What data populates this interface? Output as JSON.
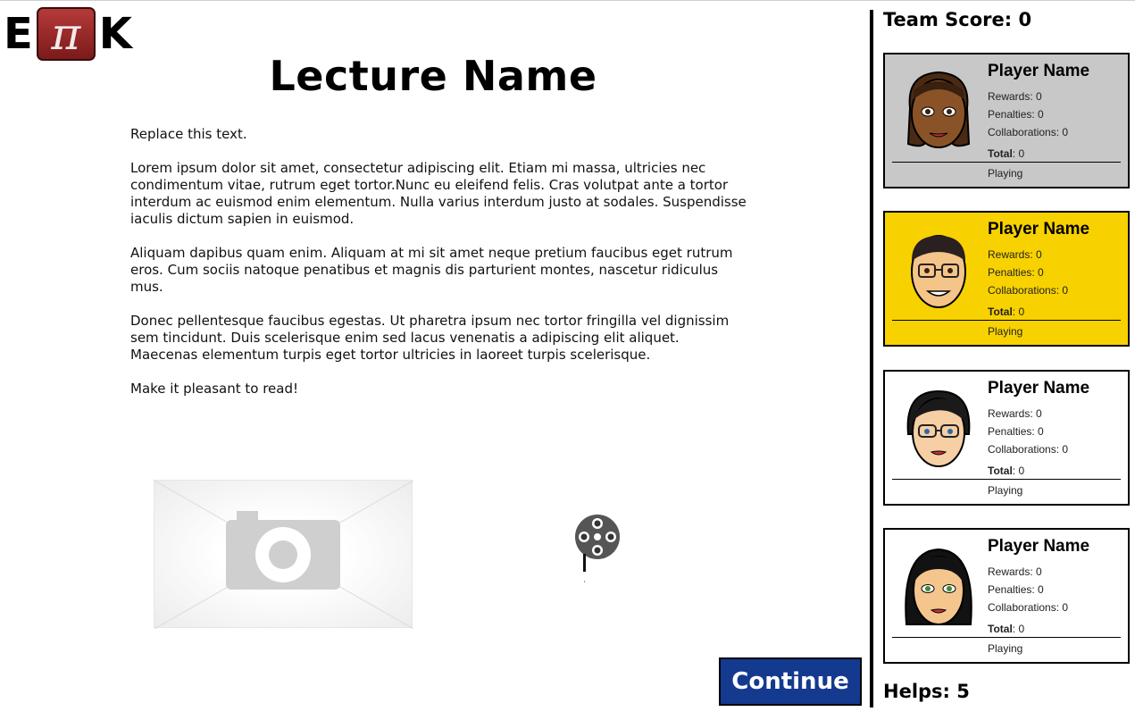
{
  "logo": {
    "left": "E",
    "middle": "π",
    "right": "K"
  },
  "lecture": {
    "title": "Lecture Name",
    "paragraphs": [
      "Replace this text.",
      "Lorem ipsum dolor sit amet, consectetur adipiscing elit. Etiam mi massa, ultricies nec condimentum vitae, rutrum eget tortor.Nunc eu eleifend felis. Cras volutpat ante a tortor interdum ac euismod enim elementum. Nulla varius interdum justo at sodales. Suspendisse iaculis dictum sapien in euismod.",
      "Aliquam dapibus quam enim. Aliquam at mi sit amet neque pretium faucibus eget rutrum eros. Cum sociis natoque penatibus et magnis dis parturient montes, nascetur ridiculus mus.",
      "Donec pellentesque faucibus egestas. Ut pharetra ipsum nec tortor fringilla vel dignissim sem tincidunt. Duis scelerisque enim sed lacus venenatis a adipiscing elit aliquet. Maecenas elementum turpis eget tortor ultricies in laoreet turpis scelerisque.",
      "Make it pleasant to read!"
    ]
  },
  "media": {
    "image_icon": "camera-icon",
    "video_icon": "film-reel-icon"
  },
  "continue_label": "Continue",
  "sidebar": {
    "team_score": "Team Score: 0",
    "helps": "Helps: 5",
    "stat_labels": {
      "rewards": "Rewards:",
      "penalties": "Penalties:",
      "collaborations": "Collaborations:",
      "total": "Total"
    },
    "players": [
      {
        "name": "Player Name",
        "rewards": "0",
        "penalties": "0",
        "collaborations": "0",
        "total": "0",
        "status": "Playing",
        "background": "#c8c8c8",
        "avatar_icon": "avatar-woman-dark-skin-icon"
      },
      {
        "name": "Player Name",
        "rewards": "0",
        "penalties": "0",
        "collaborations": "0",
        "total": "0",
        "status": "Playing",
        "background": "#f8d200",
        "avatar_icon": "avatar-man-glasses-icon"
      },
      {
        "name": "Player Name",
        "rewards": "0",
        "penalties": "0",
        "collaborations": "0",
        "total": "0",
        "status": "Playing",
        "background": "#ffffff",
        "avatar_icon": "avatar-woman-glasses-icon"
      },
      {
        "name": "Player Name",
        "rewards": "0",
        "penalties": "0",
        "collaborations": "0",
        "total": "0",
        "status": "Playing",
        "background": "#ffffff",
        "avatar_icon": "avatar-woman-black-hair-icon"
      }
    ]
  },
  "colors": {
    "continue_button": "#143a8f",
    "logo_pi": "#9a2828",
    "active_player": "#f8d200"
  }
}
